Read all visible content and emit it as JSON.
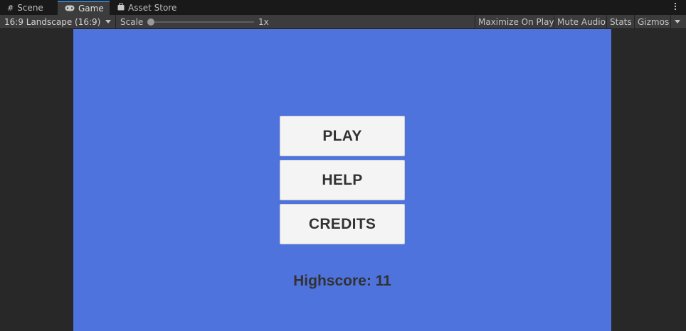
{
  "tabs": [
    {
      "label": "Scene",
      "icon": "grid-icon"
    },
    {
      "label": "Game",
      "icon": "gamepad-icon"
    },
    {
      "label": "Asset Store",
      "icon": "shopping-bag-icon"
    }
  ],
  "toolbar": {
    "aspect": "16:9 Landscape (16:9)",
    "scale_label": "Scale",
    "scale_value": "1x",
    "maximize": "Maximize On Play",
    "mute": "Mute Audio",
    "stats": "Stats",
    "gizmos": "Gizmos"
  },
  "game": {
    "buttons": {
      "play": "PLAY",
      "help": "HELP",
      "credits": "CREDITS"
    },
    "highscore": "Highscore: 11"
  },
  "colors": {
    "game_background": "#4f73dd",
    "button_background": "#f4f4f4",
    "button_text": "#323232",
    "active_tab_accent": "#3a79bb"
  }
}
